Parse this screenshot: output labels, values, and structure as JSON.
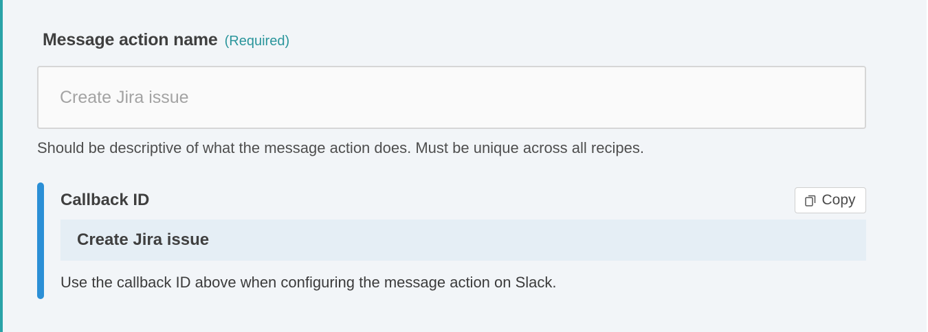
{
  "form": {
    "field_label": "Message action name",
    "required_label": "(Required)",
    "input_placeholder": "Create Jira issue",
    "input_value": "",
    "help_text": "Should be descriptive of what the message action does. Must be unique across all recipes."
  },
  "callback": {
    "title": "Callback ID",
    "copy_label": "Copy",
    "copy_icon": "copy-icon",
    "value": "Create Jira issue",
    "help_text": "Use the callback ID above when configuring the message action on Slack."
  },
  "colors": {
    "accent_teal": "#2a959b",
    "callout_bar_blue": "#2b8fd6",
    "background": "#f2f5f8",
    "value_box": "#e5eef5"
  }
}
